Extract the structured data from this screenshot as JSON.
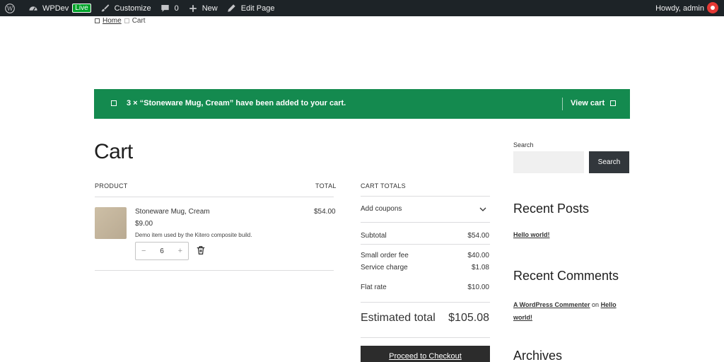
{
  "adminbar": {
    "site_name": "WPDev",
    "live_badge": "Live",
    "customize": "Customize",
    "comments_count": "0",
    "new_label": "New",
    "edit_page": "Edit Page",
    "howdy": "Howdy, admin"
  },
  "breadcrumb": {
    "home": "Home",
    "current": "Cart"
  },
  "notice": {
    "message": "3 × “Stoneware Mug, Cream” have been added to your cart.",
    "view_cart": "View cart"
  },
  "cart": {
    "title": "Cart",
    "col_product": "PRODUCT",
    "col_total": "TOTAL",
    "item": {
      "name": "Stoneware Mug, Cream",
      "price": "$9.00",
      "description": "Demo item used by the Kitero composite build.",
      "quantity": "6",
      "total": "$54.00"
    }
  },
  "totals": {
    "heading": "CART TOTALS",
    "add_coupons": "Add coupons",
    "subtotal_label": "Subtotal",
    "subtotal_value": "$54.00",
    "fee_label": "Small order fee",
    "fee_value": "$40.00",
    "service_label": "Service charge",
    "service_value": "$1.08",
    "shipping_label": "Flat rate",
    "shipping_value": "$10.00",
    "estimated_label": "Estimated total",
    "estimated_value": "$105.08",
    "checkout_label": "Proceed to Checkout"
  },
  "sidebar": {
    "search_label": "Search",
    "search_button": "Search",
    "recent_posts_title": "Recent Posts",
    "recent_posts": [
      "Hello world!"
    ],
    "recent_comments_title": "Recent Comments",
    "comment_author": "A WordPress Commenter",
    "comment_on": "on",
    "comment_post": "Hello world!",
    "archives_title": "Archives"
  },
  "colors": {
    "adminbar_bg": "#1d2327",
    "notice_bg": "#148a4f",
    "button_dark": "#2c2c2c"
  }
}
